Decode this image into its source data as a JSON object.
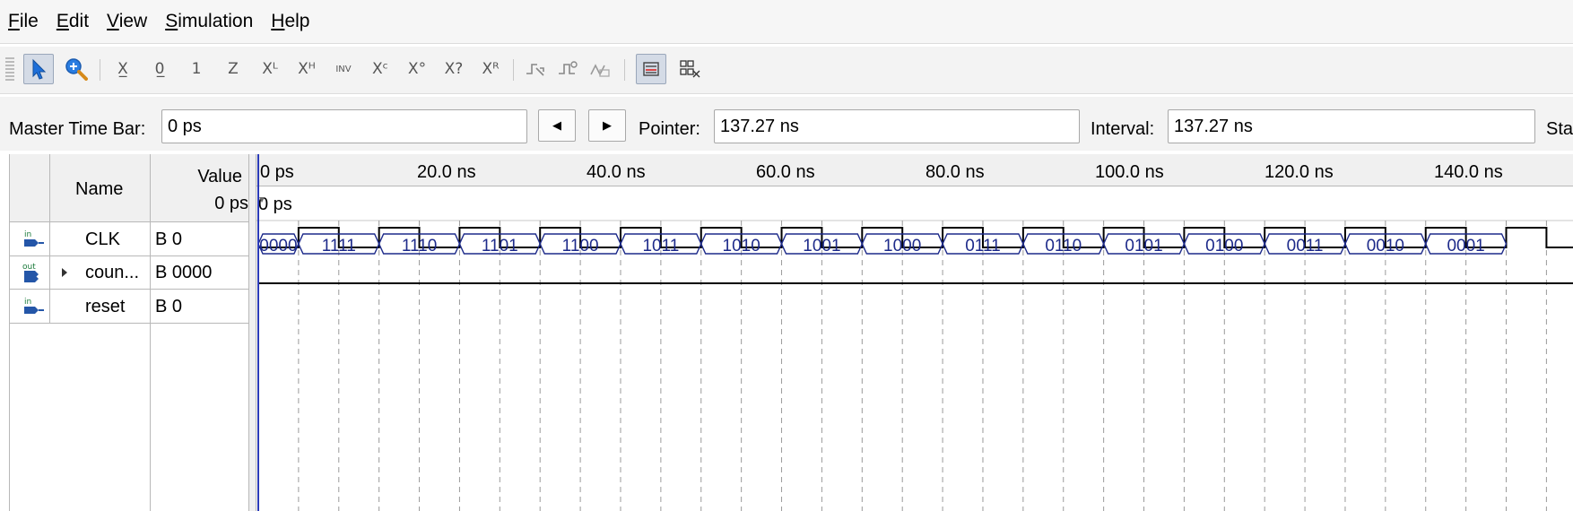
{
  "menu": [
    {
      "ul": "F",
      "rest": "ile"
    },
    {
      "ul": "E",
      "rest": "dit"
    },
    {
      "ul": "V",
      "rest": "iew"
    },
    {
      "ul": "S",
      "rest": "imulation"
    },
    {
      "ul": "H",
      "rest": "elp"
    }
  ],
  "toolbar": {
    "icons": [
      "selection-tool-icon",
      "zoom-tool-icon",
      "forcing-unknown-icon",
      "forcing-low-icon",
      "forcing-high-icon",
      "high-impedance-icon",
      "weak-low-icon",
      "weak-high-icon",
      "invert-icon",
      "count-value-icon",
      "clock-value-icon",
      "arbitrary-value-icon",
      "random-value-icon",
      "snap-to-transition-icon",
      "snap-to-edge-icon",
      "waveform-editing-icon",
      "bus-grouping-icon",
      "ungroup-icon"
    ],
    "glyphs": {
      "forcing-unknown-icon": "X̲",
      "forcing-low-icon": "0̲",
      "forcing-high-icon": "1",
      "high-impedance-icon": "Z",
      "weak-low-icon": "Xᴸ",
      "weak-high-icon": "Xᴴ",
      "invert-icon": "INV",
      "count-value-icon": "Xᶜ",
      "clock-value-icon": "X°",
      "arbitrary-value-icon": "X?",
      "random-value-icon": "Xᴿ"
    }
  },
  "timebar": {
    "master_label": "Master Time Bar:",
    "master_value": "0 ps",
    "pointer_label": "Pointer:",
    "pointer_value": "137.27 ns",
    "interval_label": "Interval:",
    "interval_value": "137.27 ns",
    "start_label": "Sta"
  },
  "grid": {
    "col_name": "Name",
    "col_value": "Value",
    "col_value_time": "0 ps",
    "time_cursor": "0 ps",
    "ruler": [
      "0 ps",
      "20.0 ns",
      "40.0 ns",
      "60.0 ns",
      "80.0 ns",
      "100.0 ns",
      "120.0 ns",
      "140.0 ns"
    ],
    "signals": [
      {
        "direction": "in",
        "name": "CLK",
        "value": "B 0",
        "expandable": false
      },
      {
        "direction": "out",
        "name": "coun...",
        "value": "B 0000",
        "expandable": true
      },
      {
        "direction": "in",
        "name": "reset",
        "value": "B 0",
        "expandable": false
      }
    ],
    "counter_segments": [
      "0000",
      "1111",
      "1110",
      "1101",
      "1100",
      "1011",
      "1010",
      "1001",
      "1000",
      "0111",
      "0110",
      "0101",
      "0100",
      "0011",
      "0010",
      "0001"
    ]
  },
  "colors": {
    "wave": "#000000",
    "bus": "#1d2a8a",
    "cursor": "#2b3bb8",
    "icon_in": "#2456a8"
  }
}
